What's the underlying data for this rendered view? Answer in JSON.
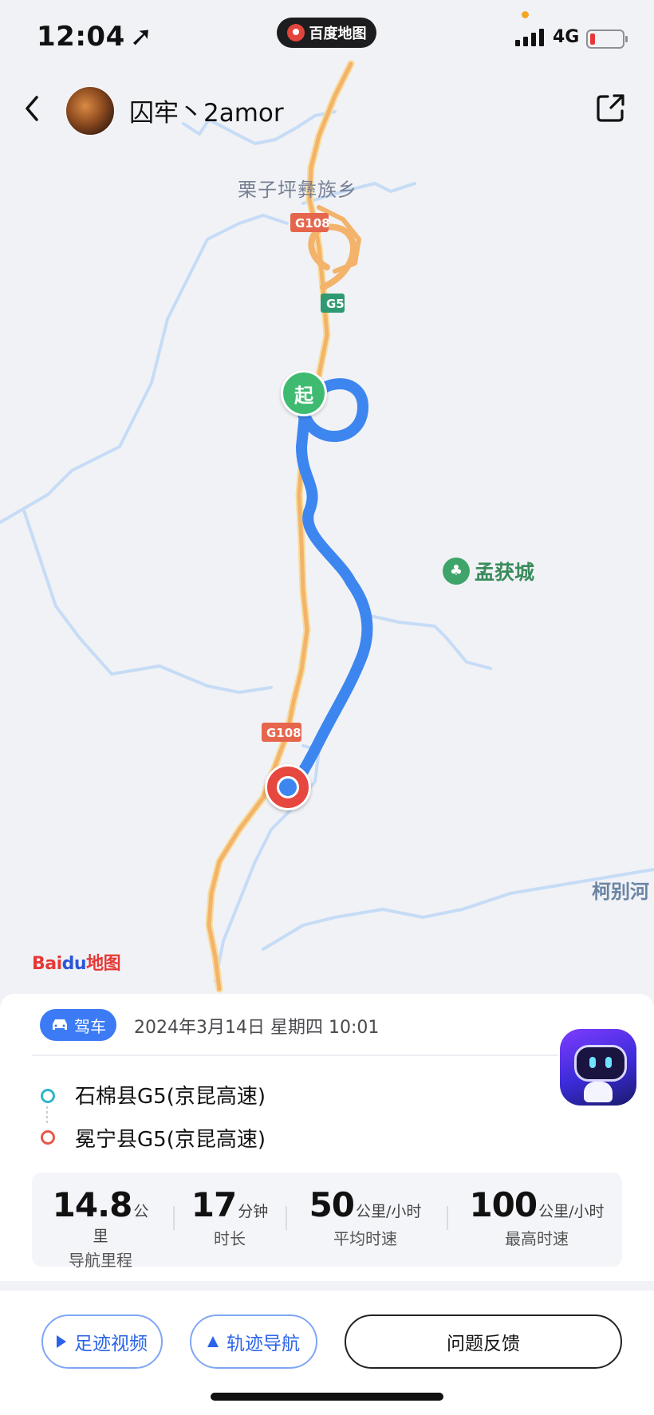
{
  "status_bar": {
    "time": "12:04",
    "app_name": "百度地图",
    "network": "4G"
  },
  "header": {
    "username": "囚牢丶2amor"
  },
  "map": {
    "place_label": "栗子坪彝族乡",
    "poi_name": "孟获城",
    "river_label": "柯别河",
    "highway_shields": [
      "G108",
      "G5",
      "G108"
    ],
    "start_marker_label": "起",
    "logo_text": "Bai",
    "logo_du": "du",
    "logo_suffix": "地图",
    "route_color": "#3d86f0",
    "road_color": "#f3b36a",
    "river_color": "#c6dcf6"
  },
  "trip": {
    "mode_label": "驾车",
    "datetime": "2024年3月14日 星期四 10:01",
    "from": "石棉县G5(京昆高速)",
    "to": "冕宁县G5(京昆高速)"
  },
  "stats": [
    {
      "value": "14.8",
      "unit": "公里",
      "label": "导航里程"
    },
    {
      "value": "17",
      "unit": "分钟",
      "label": "时长"
    },
    {
      "value": "50",
      "unit": "公里/小时",
      "label": "平均时速"
    },
    {
      "value": "100",
      "unit": "公里/小时",
      "label": "最高时速"
    }
  ],
  "actions": {
    "footprint_video": "足迹视频",
    "track_nav": "轨迹导航",
    "feedback": "问题反馈"
  }
}
